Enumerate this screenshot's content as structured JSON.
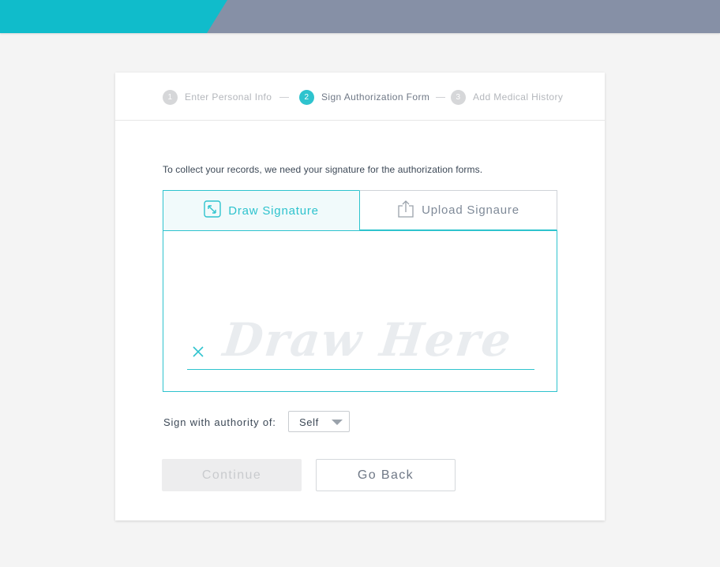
{
  "stepper": {
    "steps": [
      {
        "number": "1",
        "label": "Enter Personal Info"
      },
      {
        "number": "2",
        "label": "Sign Authorization Form"
      },
      {
        "number": "3",
        "label": "Add Medical History"
      }
    ],
    "active_step": 2
  },
  "intro_text": "To collect your records, we need your signature for the authorization forms.",
  "signature": {
    "tabs": [
      {
        "label": "Draw Signature",
        "icon": "draw-signature-icon",
        "selected": true
      },
      {
        "label": "Upload Signaure",
        "icon": "upload-icon",
        "selected": false
      }
    ],
    "placeholder": "Draw Here",
    "clear_icon": "close-icon"
  },
  "authority": {
    "label": "Sign with authority of:",
    "selected": "Self"
  },
  "buttons": {
    "continue_label": "Continue",
    "continue_disabled": true,
    "back_label": "Go Back"
  },
  "colors": {
    "accent": "#2ec3ce",
    "header_teal": "#10bccb",
    "header_gray": "#8690a6"
  }
}
